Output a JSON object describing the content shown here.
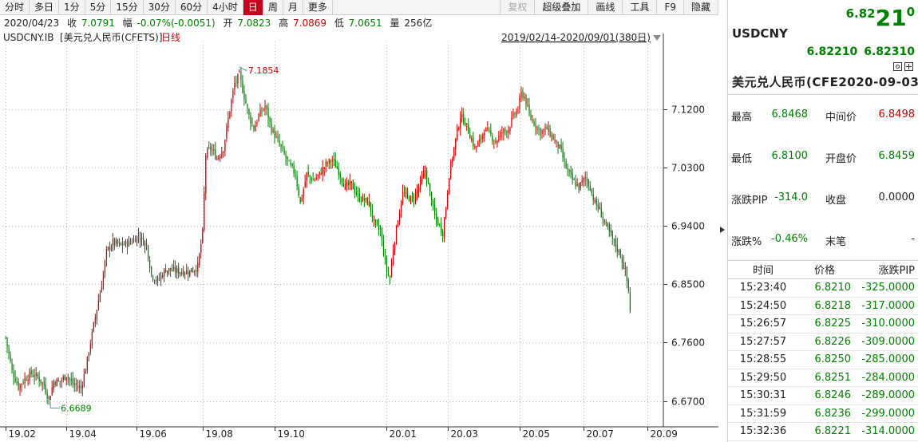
{
  "toolbar": {
    "buttons": [
      "分时",
      "多日",
      "1分",
      "5分",
      "15分",
      "30分",
      "60分",
      "4小时",
      "日",
      "周",
      "月",
      "更多"
    ],
    "active": "日",
    "right_buttons": [
      "复权",
      "超级叠加",
      "画线",
      "工具",
      "F9",
      "隐藏"
    ]
  },
  "quote_bar": {
    "date": "2020/04/23",
    "close_label": "收",
    "close": "7.0791",
    "range_label": "幅",
    "range": "-0.07%(-0.0051)",
    "open_label": "开",
    "open": "7.0823",
    "high_label": "高",
    "high": "7.0869",
    "low_label": "低",
    "low": "7.0651",
    "volume_label": "量",
    "volume": "256亿"
  },
  "chart_header": {
    "symbol": "USDCNY.IB",
    "name": "[美元兑人民币(CFETS)]",
    "period": "日线",
    "range": "2019/02/14-2020/09/01(380日)"
  },
  "colors": {
    "up": "#d00000",
    "down": "#008000",
    "accent": "#c8001e"
  },
  "chart_data": {
    "type": "candlestick",
    "title": "USDCNY.IB [美元兑人民币(CFETS)] 日线",
    "xlabel": "",
    "ylabel": "",
    "ylim": [
      6.63,
      7.22
    ],
    "yticks": [
      6.67,
      6.76,
      6.85,
      6.94,
      7.03,
      7.12
    ],
    "ytick_labels": [
      "6.6700",
      "6.7600",
      "6.8500",
      "6.9400",
      "7.0300",
      "7.1200"
    ],
    "xtick_labels": [
      "19.02",
      "19.04",
      "19.06",
      "19.08",
      "19.10",
      "20.01",
      "20.03",
      "20.05",
      "20.07",
      "20.09"
    ],
    "xtick_positions": [
      0,
      38,
      82,
      123,
      168,
      238,
      276,
      321,
      361,
      401
    ],
    "annotations": [
      {
        "text": "7.1854",
        "x": 146,
        "y": 7.1854
      },
      {
        "text": "6.6689",
        "x": 28,
        "y": 6.6689
      }
    ],
    "anchors": [
      [
        0,
        6.768
      ],
      [
        4,
        6.716
      ],
      [
        8,
        6.692
      ],
      [
        12,
        6.704
      ],
      [
        16,
        6.712
      ],
      [
        20,
        6.707
      ],
      [
        24,
        6.694
      ],
      [
        27,
        6.672
      ],
      [
        30,
        6.7
      ],
      [
        34,
        6.7
      ],
      [
        38,
        6.71
      ],
      [
        42,
        6.696
      ],
      [
        47,
        6.69
      ],
      [
        50,
        6.72
      ],
      [
        53,
        6.76
      ],
      [
        56,
        6.8
      ],
      [
        60,
        6.85
      ],
      [
        63,
        6.9
      ],
      [
        67,
        6.915
      ],
      [
        72,
        6.91
      ],
      [
        78,
        6.915
      ],
      [
        83,
        6.925
      ],
      [
        88,
        6.91
      ],
      [
        91,
        6.865
      ],
      [
        95,
        6.855
      ],
      [
        100,
        6.873
      ],
      [
        108,
        6.87
      ],
      [
        115,
        6.87
      ],
      [
        120,
        6.877
      ],
      [
        123,
        6.93
      ],
      [
        125,
        7.05
      ],
      [
        128,
        7.06
      ],
      [
        132,
        7.045
      ],
      [
        136,
        7.06
      ],
      [
        140,
        7.12
      ],
      [
        143,
        7.16
      ],
      [
        146,
        7.173
      ],
      [
        149,
        7.14
      ],
      [
        152,
        7.11
      ],
      [
        155,
        7.09
      ],
      [
        158,
        7.11
      ],
      [
        162,
        7.125
      ],
      [
        166,
        7.09
      ],
      [
        170,
        7.07
      ],
      [
        174,
        7.05
      ],
      [
        177,
        7.035
      ],
      [
        181,
        7.02
      ],
      [
        184,
        6.975
      ],
      [
        188,
        7.02
      ],
      [
        192,
        7.01
      ],
      [
        196,
        7.02
      ],
      [
        200,
        7.035
      ],
      [
        204,
        7.042
      ],
      [
        208,
        7.025
      ],
      [
        212,
        7.0
      ],
      [
        216,
        7.005
      ],
      [
        220,
        6.985
      ],
      [
        224,
        6.98
      ],
      [
        227,
        6.975
      ],
      [
        230,
        6.945
      ],
      [
        234,
        6.93
      ],
      [
        236,
        6.9
      ],
      [
        238,
        6.87
      ],
      [
        240,
        6.86
      ],
      [
        242,
        6.905
      ],
      [
        245,
        6.95
      ],
      [
        248,
        6.99
      ],
      [
        251,
        6.985
      ],
      [
        254,
        6.98
      ],
      [
        258,
        7.0
      ],
      [
        262,
        7.025
      ],
      [
        265,
        6.99
      ],
      [
        268,
        6.955
      ],
      [
        271,
        6.94
      ],
      [
        273,
        6.93
      ],
      [
        275,
        6.97
      ],
      [
        277,
        7.02
      ],
      [
        280,
        7.06
      ],
      [
        284,
        7.11
      ],
      [
        287,
        7.1
      ],
      [
        290,
        7.08
      ],
      [
        293,
        7.06
      ],
      [
        296,
        7.07
      ],
      [
        299,
        7.09
      ],
      [
        303,
        7.08
      ],
      [
        306,
        7.07
      ],
      [
        310,
        7.085
      ],
      [
        314,
        7.09
      ],
      [
        317,
        7.11
      ],
      [
        320,
        7.12
      ],
      [
        322,
        7.145
      ],
      [
        324,
        7.14
      ],
      [
        327,
        7.11
      ],
      [
        330,
        7.1
      ],
      [
        334,
        7.085
      ],
      [
        338,
        7.09
      ],
      [
        342,
        7.075
      ],
      [
        346,
        7.06
      ],
      [
        350,
        7.03
      ],
      [
        354,
        7.01
      ],
      [
        358,
        7.0
      ],
      [
        362,
        7.015
      ],
      [
        365,
        7.0
      ],
      [
        368,
        6.975
      ],
      [
        371,
        6.965
      ],
      [
        374,
        6.945
      ],
      [
        377,
        6.93
      ],
      [
        380,
        6.915
      ],
      [
        384,
        6.895
      ],
      [
        387,
        6.87
      ],
      [
        389,
        6.84
      ],
      [
        390,
        6.81
      ]
    ]
  },
  "side_panel": {
    "price_main": "6.82",
    "price_big": "21",
    "price_small": "0",
    "symbol": "USDCNY",
    "bid": "6.82210",
    "ask": "6.82310",
    "name": "美元兑人民币(CFE2020-09-03",
    "stats": [
      {
        "label": "最高",
        "value": "6.8468",
        "color": "g",
        "label2": "中间价",
        "value2": "6.8498",
        "color2": "r"
      },
      {
        "label": "最低",
        "value": "6.8100",
        "color": "g",
        "label2": "开盘价",
        "value2": "6.8459",
        "color2": "g"
      },
      {
        "label": "涨跌PIP",
        "value": "-314.0",
        "color": "g",
        "label2": "收盘",
        "value2": "0.0000",
        "color2": "k"
      },
      {
        "label": "涨跌%",
        "value": "-0.46%",
        "color": "g",
        "label2": "末笔",
        "value2": "-",
        "color2": "k"
      }
    ],
    "trades_header": [
      "时间",
      "价格",
      "涨跌PIP"
    ],
    "trades": [
      [
        "15:23:40",
        "6.8210",
        "-325.0000"
      ],
      [
        "15:24:50",
        "6.8218",
        "-317.0000"
      ],
      [
        "15:26:57",
        "6.8225",
        "-310.0000"
      ],
      [
        "15:27:57",
        "6.8226",
        "-309.0000"
      ],
      [
        "15:28:55",
        "6.8250",
        "-285.0000"
      ],
      [
        "15:29:50",
        "6.8251",
        "-284.0000"
      ],
      [
        "15:30:31",
        "6.8246",
        "-289.0000"
      ],
      [
        "15:31:59",
        "6.8236",
        "-299.0000"
      ],
      [
        "15:32:36",
        "6.8221",
        "-314.0000"
      ]
    ]
  }
}
